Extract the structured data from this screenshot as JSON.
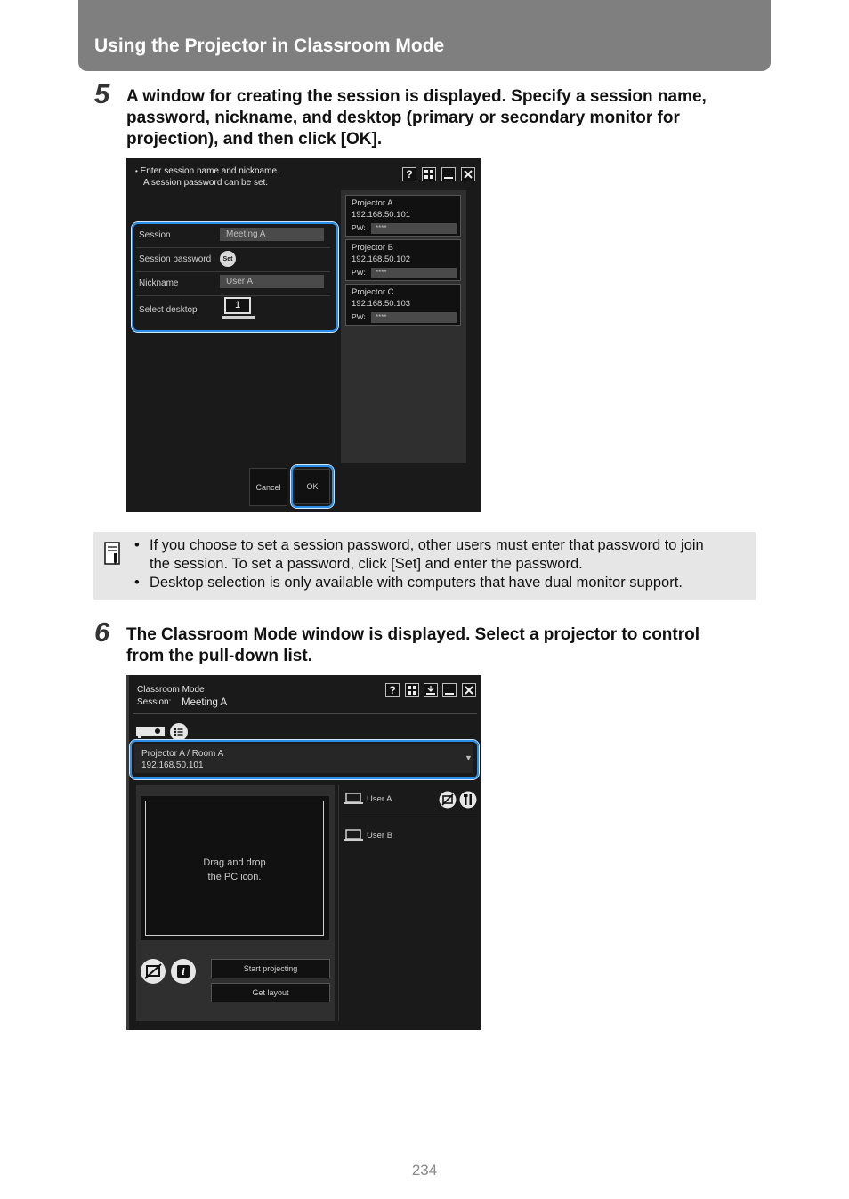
{
  "header": {
    "title": "Using the Projector in Classroom Mode"
  },
  "step5": {
    "number": "5",
    "lines": [
      "A window for creating the session is displayed. Specify a session name,",
      "password, nickname, and desktop (primary or secondary monitor for",
      "projection), and then click [OK]."
    ],
    "window": {
      "instruction_1": "Enter session name and nickname.",
      "instruction_2": "A session password can be set.",
      "session_label": "Session",
      "session_value": "Meeting A",
      "password_label": "Session password",
      "password_set": "Set",
      "nickname_label": "Nickname",
      "nickname_value": "User A",
      "desktop_label": "Select desktop",
      "desktop_value": "1",
      "projectors": [
        {
          "name": "Projector A",
          "ip": "192.168.50.101",
          "pw_label": "PW:",
          "pw": "****"
        },
        {
          "name": "Projector B",
          "ip": "192.168.50.102",
          "pw_label": "PW:",
          "pw": "****"
        },
        {
          "name": "Projector C",
          "ip": "192.168.50.103",
          "pw_label": "PW:",
          "pw": "****"
        }
      ],
      "cancel": "Cancel",
      "ok": "OK"
    }
  },
  "note": {
    "bullet": "•",
    "lines": [
      "If you choose to set a session password, other users must enter that password to join",
      "the session. To set a password, click [Set] and enter the password.",
      "Desktop selection is only available with computers that have dual monitor support."
    ]
  },
  "step6": {
    "number": "6",
    "lines": [
      "The Classroom Mode window is displayed. Select a projector to control",
      "from the pull-down list."
    ],
    "window": {
      "title": "Classroom Mode",
      "session_label": "Session:",
      "session_value": "Meeting A",
      "projector_name": "Projector A / Room A",
      "projector_ip": "192.168.50.101",
      "drop_text_1": "Drag and drop",
      "drop_text_2": "the PC icon.",
      "start_projecting": "Start projecting",
      "get_layout": "Get layout",
      "users": [
        "User A",
        "User B"
      ]
    }
  },
  "page_number": "234"
}
